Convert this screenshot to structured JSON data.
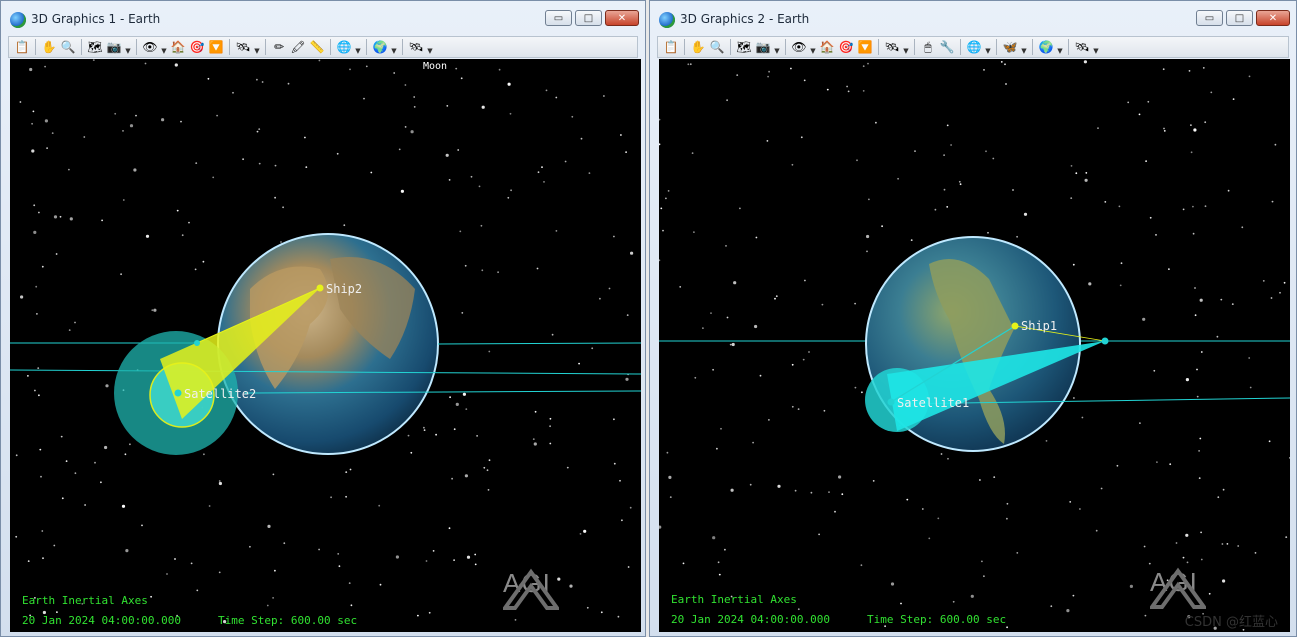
{
  "windows": [
    {
      "title": "3D Graphics 1 - Earth",
      "moon_label": "Moon",
      "ship_label": "Ship2",
      "satellite_label": "Satellite2",
      "axes_label": "Earth Inertial Axes",
      "datetime": "20 Jan 2024 04:00:00.000",
      "timestep": "Time Step: 600.00 sec",
      "logo": "AGI"
    },
    {
      "title": "3D Graphics 2 - Earth",
      "ship_label": "Ship1",
      "satellite_label": "Satellite1",
      "axes_label": "Earth Inertial Axes",
      "datetime": "20 Jan 2024 04:00:00.000",
      "timestep": "Time Step: 600.00 sec",
      "logo": "AGI"
    }
  ],
  "window_buttons": {
    "minimize": "▭",
    "maximize": "□",
    "close": "✕"
  },
  "colors": {
    "space": "#000000",
    "overlay_text": "#31e231",
    "orbit_line": "#22d3d3",
    "cone_yellow": "#e6f21a",
    "cone_cyan": "#1ee6e6",
    "footprint": "#1fb5b0"
  },
  "toolbar1_icons": [
    "notes-icon",
    "pan-hand-icon",
    "zoom-icon",
    "map-icon",
    "camera-icon",
    "view-eye-icon",
    "home-icon",
    "view-from-icon",
    "view-to-icon",
    "satellite-view-icon",
    "pencil-icon",
    "marker-icon",
    "ruler-icon",
    "globe-settings-icon",
    "globe-icon",
    "satellite-icon"
  ],
  "toolbar2_icons": [
    "notes-icon",
    "pan-hand-icon",
    "zoom-icon",
    "map-icon",
    "camera-icon",
    "view-eye-icon",
    "home-icon",
    "view-from-icon",
    "view-to-icon",
    "satellite-view-icon",
    "mouse-icon",
    "tools-icon",
    "globe-settings-icon",
    "wing-icon",
    "globe-icon",
    "satellite-icon"
  ],
  "watermark": "CSDN @红蓝心"
}
